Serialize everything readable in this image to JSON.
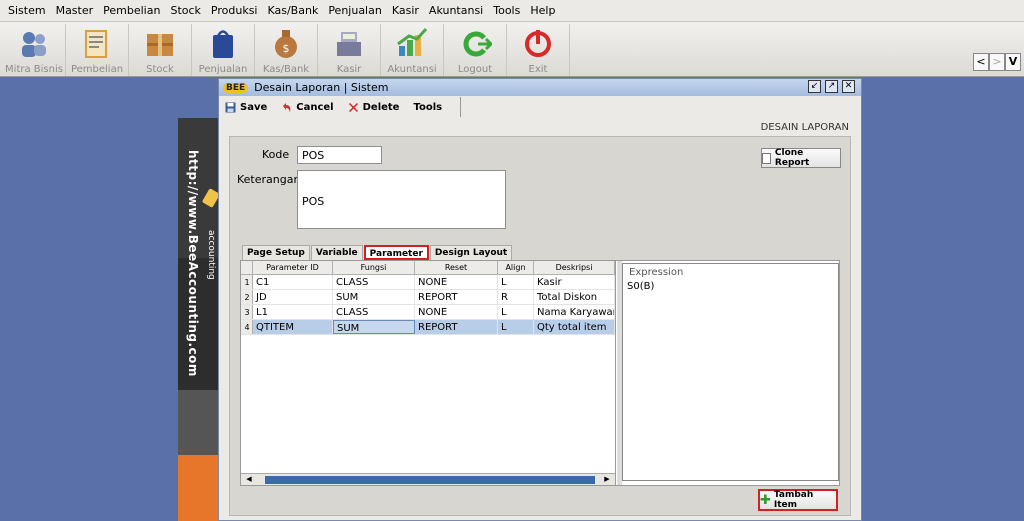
{
  "menu": [
    "Sistem",
    "Master",
    "Pembelian",
    "Stock",
    "Produksi",
    "Kas/Bank",
    "Penjualan",
    "Kasir",
    "Akuntansi",
    "Tools",
    "Help"
  ],
  "toolbar": [
    {
      "label": "Mitra Bisnis",
      "icon": "partners-icon",
      "color": "#5a7ab0"
    },
    {
      "label": "Pembelian",
      "icon": "purchase-icon",
      "color": "#d8a040"
    },
    {
      "label": "Stock",
      "icon": "stock-icon",
      "color": "#c88840"
    },
    {
      "label": "Penjualan",
      "icon": "sales-icon",
      "color": "#2a4a98"
    },
    {
      "label": "Kas/Bank",
      "icon": "money-bag-icon",
      "color": "#b87840"
    },
    {
      "label": "Kasir",
      "icon": "cashier-icon",
      "color": "#7a7a9a"
    },
    {
      "label": "Akuntansi",
      "icon": "chart-up-icon",
      "color": "#4aa848"
    },
    {
      "label": "Logout",
      "icon": "logout-icon",
      "color": "#3aa83a"
    },
    {
      "label": "Exit",
      "icon": "power-icon",
      "color": "#d82a2a"
    }
  ],
  "nav": {
    "prev": "<",
    "next": ">",
    "v": "V"
  },
  "box": {
    "url": "http://www.BeeAccounting.com",
    "small": "accounting"
  },
  "window": {
    "logo": "BEE",
    "title": "Desain Laporan | Sistem",
    "ctrl_min": "↙",
    "ctrl_max": "↗",
    "ctrl_close": "✕",
    "actions": [
      "Save",
      "Cancel",
      "Delete",
      "Tools"
    ],
    "section_title": "DESAIN LAPORAN"
  },
  "form": {
    "kode_label": "Kode",
    "kode_value": "POS",
    "keterangan_label": "Keterangan",
    "keterangan_value": "POS",
    "clone_button": "Clone Report"
  },
  "tabs": [
    "Page Setup",
    "Variable",
    "Parameter",
    "Design Layout"
  ],
  "grid": {
    "headers": [
      "Parameter ID",
      "Fungsi",
      "Reset",
      "Align",
      "Deskripsi"
    ],
    "rows": [
      {
        "n": "1",
        "id": "C1",
        "fungsi": "CLASS",
        "reset": "NONE",
        "align": "L",
        "desk": "Kasir"
      },
      {
        "n": "2",
        "id": "JD",
        "fungsi": "SUM",
        "reset": "REPORT",
        "align": "R",
        "desk": "Total Diskon"
      },
      {
        "n": "3",
        "id": "L1",
        "fungsi": "CLASS",
        "reset": "NONE",
        "align": "L",
        "desk": "Nama Karyawan"
      },
      {
        "n": "4",
        "id": "QTITEM",
        "fungsi": "SUM",
        "reset": "REPORT",
        "align": "L",
        "desk": "Qty total item"
      }
    ]
  },
  "expression": {
    "header": "Expression",
    "value": "S0(B)"
  },
  "add_button": "Tambah Item"
}
